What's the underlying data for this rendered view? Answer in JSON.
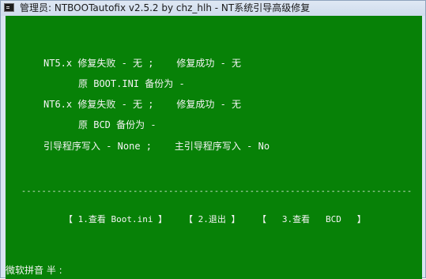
{
  "window": {
    "title": "管理员:  NTBOOTautofix v2.5.2 by chz_hlh - NT系统引导高级修复",
    "icon": "console-icon"
  },
  "console": {
    "nt5_line": "NT5.x 修复失败 - 无 ;    修复成功 - 无",
    "nt5_backup": "原 BOOT.INI 备份为 -",
    "nt6_line": "NT6.x 修复失败 - 无 ;    修复成功 - 无",
    "nt6_backup": "原 BCD 备份为 -",
    "boot_write": "引导程序写入 - None ;    主引导程序写入 - No",
    "separator": "--------------------------------------------------------------------------------------------",
    "menu": {
      "view_bootini": "【 1.查看 Boot.ini 】",
      "exit": "【 2.退出 】",
      "view_bcd": "【   3.查看   BCD   】"
    },
    "ime_status": "微软拼音 半 :"
  },
  "colors": {
    "console_bg": "#078107",
    "console_text": "#f4f4f4",
    "titlebar": "#d9e4f1"
  }
}
